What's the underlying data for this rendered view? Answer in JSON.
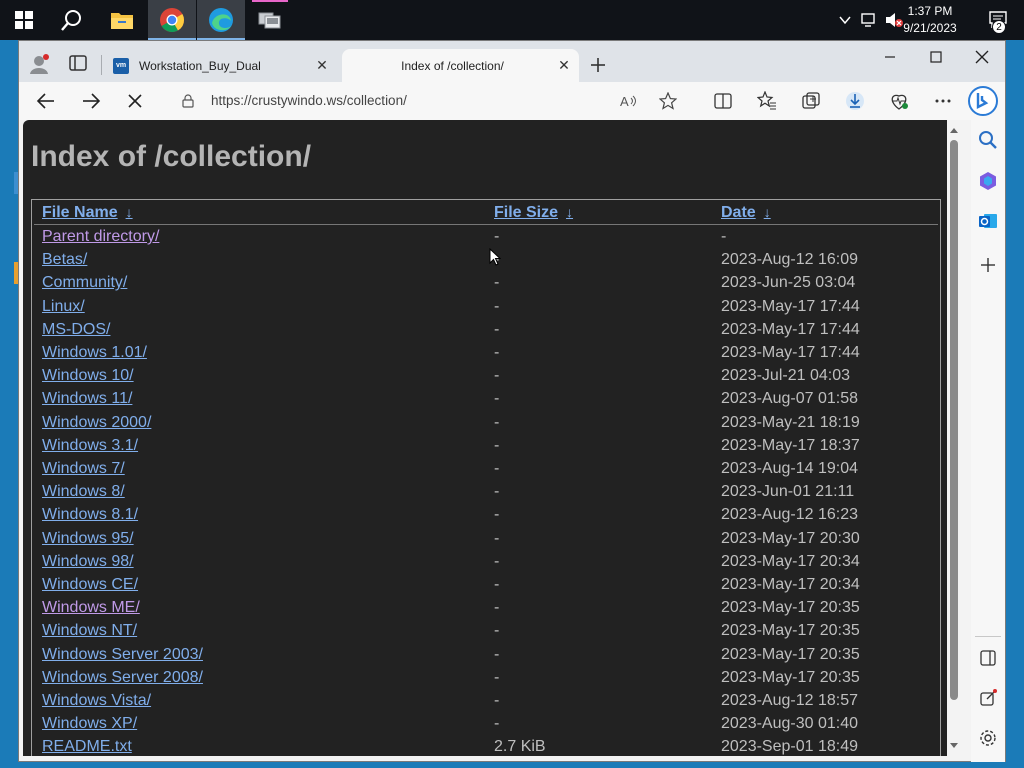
{
  "taskbar": {
    "start_label": "Start",
    "apps": [
      "file-explorer",
      "chrome",
      "edge",
      "vmware-workstation"
    ],
    "clock_time": "1:37 PM",
    "clock_date": "9/21/2023",
    "notification_count": "2"
  },
  "browser": {
    "tabs": [
      {
        "title": "Workstation_Buy_Dual",
        "favicon_text": "vm",
        "active": false
      },
      {
        "title": "Index of /collection/",
        "active": true
      }
    ],
    "address": "https://crustywindo.ws/collection/"
  },
  "page": {
    "title": "Index of /collection/",
    "columns": {
      "name": "File Name",
      "size": "File Size",
      "date": "Date",
      "sort_arrow": "↓"
    },
    "rows": [
      {
        "name": "Parent directory/",
        "size": "-",
        "date": "-",
        "visited": true
      },
      {
        "name": "Betas/",
        "size": "-",
        "date": "2023-Aug-12 16:09",
        "visited": false
      },
      {
        "name": "Community/",
        "size": "-",
        "date": "2023-Jun-25 03:04",
        "visited": false
      },
      {
        "name": "Linux/",
        "size": "-",
        "date": "2023-May-17 17:44",
        "visited": false
      },
      {
        "name": "MS-DOS/",
        "size": "-",
        "date": "2023-May-17 17:44",
        "visited": false
      },
      {
        "name": "Windows 1.01/",
        "size": "-",
        "date": "2023-May-17 17:44",
        "visited": false
      },
      {
        "name": "Windows 10/",
        "size": "-",
        "date": "2023-Jul-21 04:03",
        "visited": false
      },
      {
        "name": "Windows 11/",
        "size": "-",
        "date": "2023-Aug-07 01:58",
        "visited": false
      },
      {
        "name": "Windows 2000/",
        "size": "-",
        "date": "2023-May-21 18:19",
        "visited": false
      },
      {
        "name": "Windows 3.1/",
        "size": "-",
        "date": "2023-May-17 18:37",
        "visited": false
      },
      {
        "name": "Windows 7/",
        "size": "-",
        "date": "2023-Aug-14 19:04",
        "visited": false
      },
      {
        "name": "Windows 8/",
        "size": "-",
        "date": "2023-Jun-01 21:11",
        "visited": false
      },
      {
        "name": "Windows 8.1/",
        "size": "-",
        "date": "2023-Aug-12 16:23",
        "visited": false
      },
      {
        "name": "Windows 95/",
        "size": "-",
        "date": "2023-May-17 20:30",
        "visited": false
      },
      {
        "name": "Windows 98/",
        "size": "-",
        "date": "2023-May-17 20:34",
        "visited": false
      },
      {
        "name": "Windows CE/",
        "size": "-",
        "date": "2023-May-17 20:34",
        "visited": false
      },
      {
        "name": "Windows ME/",
        "size": "-",
        "date": "2023-May-17 20:35",
        "visited": true
      },
      {
        "name": "Windows NT/",
        "size": "-",
        "date": "2023-May-17 20:35",
        "visited": false
      },
      {
        "name": "Windows Server 2003/",
        "size": "-",
        "date": "2023-May-17 20:35",
        "visited": false
      },
      {
        "name": "Windows Server 2008/",
        "size": "-",
        "date": "2023-May-17 20:35",
        "visited": false
      },
      {
        "name": "Windows Vista/",
        "size": "-",
        "date": "2023-Aug-12 18:57",
        "visited": false
      },
      {
        "name": "Windows XP/",
        "size": "-",
        "date": "2023-Aug-30 01:40",
        "visited": false
      },
      {
        "name": "README.txt",
        "size": "2.7 KiB",
        "date": "2023-Sep-01 18:49",
        "visited": false
      }
    ]
  },
  "colors": {
    "page_bg": "#222222",
    "link": "#80aeeb",
    "visited_link": "#c09ae8",
    "text": "#bfbfbf",
    "title": "#b4b4b4"
  }
}
